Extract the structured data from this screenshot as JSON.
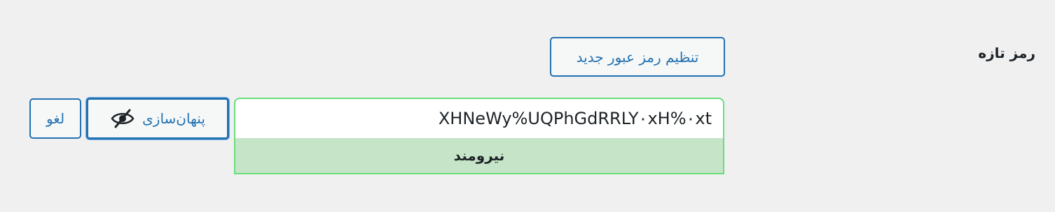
{
  "label": "رمز تازه",
  "generate_button": "تنظیم رمز عبور جدید",
  "password_value": "XHNeWy%UQPhGdRRLY۰xH%۰xt",
  "strength": "نیرومند",
  "hide_button": "پنهان‌سازی",
  "cancel_button": "لغو",
  "icons": {
    "hide": "eye-slash-icon"
  },
  "colors": {
    "accent": "#2271b1",
    "strong_bg": "#c6e5c8",
    "strong_border": "#68de7c",
    "background": "#f0f0f1"
  }
}
